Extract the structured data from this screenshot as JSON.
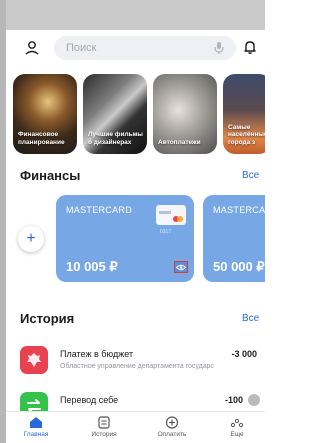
{
  "search": {
    "placeholder": "Поиск"
  },
  "stories": [
    {
      "label": "Финансовое планирование"
    },
    {
      "label": "Лучшие фильмы о дизайнерах"
    },
    {
      "label": "Автоплатежи"
    },
    {
      "label": "Самые населённые города з"
    }
  ],
  "finances": {
    "title": "Финансы",
    "link": "Все",
    "add_label": "+",
    "cards": [
      {
        "brand": "MASTERCARD",
        "last4": "0317",
        "balance": "10 005 ₽"
      },
      {
        "brand": "MASTERCA",
        "balance": "50 000 ₽"
      }
    ]
  },
  "history": {
    "title": "История",
    "link": "Все",
    "items": [
      {
        "title": "Платеж в бюджет",
        "subtitle": "Областное управление департамента государс",
        "amount": "-3 000",
        "icon_color": "#e8414f"
      },
      {
        "title": "Перевод себе",
        "amount": "-100",
        "icon_color": "#35c24a"
      }
    ]
  },
  "tabbar": {
    "items": [
      {
        "label": "Главная",
        "icon": "home-icon",
        "active": true
      },
      {
        "label": "История",
        "icon": "history-icon",
        "active": false
      },
      {
        "label": "Оплатить",
        "icon": "pay-icon",
        "active": false
      },
      {
        "label": "Еще",
        "icon": "more-icon",
        "active": false
      }
    ]
  },
  "colors": {
    "accent": "#2a69d9",
    "card": "#78a7e6"
  }
}
